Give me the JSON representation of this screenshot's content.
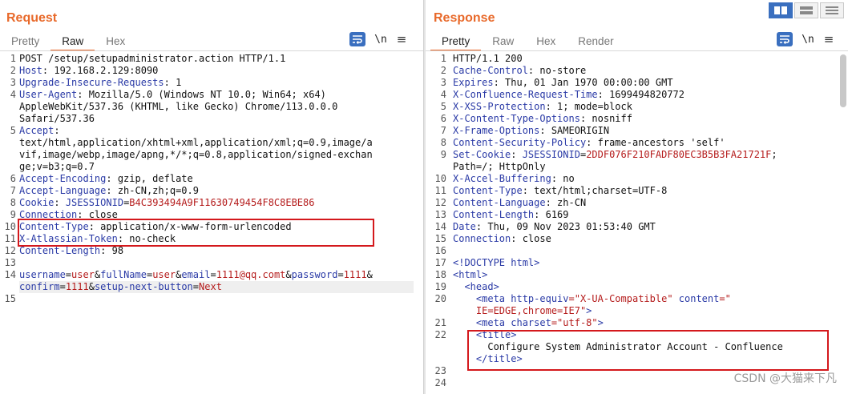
{
  "request": {
    "title": "Request",
    "tabs": [
      {
        "label": "Pretty",
        "active": false
      },
      {
        "label": "Raw",
        "active": true
      },
      {
        "label": "Hex",
        "active": false
      }
    ],
    "newline_label": "\\n",
    "menu_label": "≡",
    "lines": [
      {
        "n": "1",
        "parts": [
          {
            "t": "POST /setup/setupadministrator.action HTTP/1.1",
            "c": "hv"
          }
        ]
      },
      {
        "n": "2",
        "parts": [
          {
            "t": "Host",
            "c": "hk"
          },
          {
            "t": ": 192.168.2.129:8090",
            "c": "hv"
          }
        ]
      },
      {
        "n": "3",
        "parts": [
          {
            "t": "Upgrade-Insecure-Requests",
            "c": "hk"
          },
          {
            "t": ": 1",
            "c": "hv"
          }
        ]
      },
      {
        "n": "4",
        "parts": [
          {
            "t": "User-Agent",
            "c": "hk"
          },
          {
            "t": ": Mozilla/5.0 (Windows NT 10.0; Win64; x64)",
            "c": "hv"
          }
        ]
      },
      {
        "n": "",
        "parts": [
          {
            "t": "AppleWebKit/537.36 (KHTML, like Gecko) Chrome/113.0.0.0",
            "c": "hv"
          }
        ]
      },
      {
        "n": "",
        "parts": [
          {
            "t": "Safari/537.36",
            "c": "hv"
          }
        ]
      },
      {
        "n": "5",
        "parts": [
          {
            "t": "Accept",
            "c": "hk"
          },
          {
            "t": ":",
            "c": "hv"
          }
        ]
      },
      {
        "n": "",
        "parts": [
          {
            "t": "text/html,application/xhtml+xml,application/xml;q=0.9,image/a",
            "c": "hv"
          }
        ]
      },
      {
        "n": "",
        "parts": [
          {
            "t": "vif,image/webp,image/apng,*/*;q=0.8,application/signed-exchan",
            "c": "hv"
          }
        ]
      },
      {
        "n": "",
        "parts": [
          {
            "t": "ge;v=b3;q=0.7",
            "c": "hv"
          }
        ]
      },
      {
        "n": "6",
        "parts": [
          {
            "t": "Accept-Encoding",
            "c": "hk"
          },
          {
            "t": ": gzip, deflate",
            "c": "hv"
          }
        ]
      },
      {
        "n": "7",
        "parts": [
          {
            "t": "Accept-Language",
            "c": "hk"
          },
          {
            "t": ": zh-CN,zh;q=0.9",
            "c": "hv"
          }
        ]
      },
      {
        "n": "8",
        "parts": [
          {
            "t": "Cookie",
            "c": "hk"
          },
          {
            "t": ": ",
            "c": "hv"
          },
          {
            "t": "JSESSIONID",
            "c": "ck"
          },
          {
            "t": "=",
            "c": "hv"
          },
          {
            "t": "B4C393494A9F11630749454F8C8EBE86",
            "c": "cv"
          }
        ]
      },
      {
        "n": "9",
        "parts": [
          {
            "t": "Connection",
            "c": "hk"
          },
          {
            "t": ": close",
            "c": "hv"
          }
        ]
      },
      {
        "n": "10",
        "parts": [
          {
            "t": "Content-Type",
            "c": "hk"
          },
          {
            "t": ": application/x-www-form-urlencoded",
            "c": "hv"
          }
        ]
      },
      {
        "n": "11",
        "parts": [
          {
            "t": "X-Atlassian-Token",
            "c": "hk"
          },
          {
            "t": ": no-check",
            "c": "hv"
          }
        ]
      },
      {
        "n": "12",
        "parts": [
          {
            "t": "Content-Length",
            "c": "hk"
          },
          {
            "t": ": 98",
            "c": "hv"
          }
        ]
      },
      {
        "n": "13",
        "parts": []
      },
      {
        "n": "14",
        "parts": [
          {
            "t": "username",
            "c": "pk"
          },
          {
            "t": "=",
            "c": "amp"
          },
          {
            "t": "user",
            "c": "pv"
          },
          {
            "t": "&",
            "c": "amp"
          },
          {
            "t": "fullName",
            "c": "pk"
          },
          {
            "t": "=",
            "c": "amp"
          },
          {
            "t": "user",
            "c": "pv"
          },
          {
            "t": "&",
            "c": "amp"
          },
          {
            "t": "email",
            "c": "pk"
          },
          {
            "t": "=",
            "c": "amp"
          },
          {
            "t": "1111@qq.comt",
            "c": "pv"
          },
          {
            "t": "&",
            "c": "amp"
          },
          {
            "t": "password",
            "c": "pk"
          },
          {
            "t": "=",
            "c": "amp"
          },
          {
            "t": "1111",
            "c": "pv"
          },
          {
            "t": "&",
            "c": "amp"
          }
        ]
      },
      {
        "n": "",
        "parts": [
          {
            "t": "confirm",
            "c": "pk"
          },
          {
            "t": "=",
            "c": "amp"
          },
          {
            "t": "1111",
            "c": "pv"
          },
          {
            "t": "&",
            "c": "amp"
          },
          {
            "t": "setup-next-button",
            "c": "pk"
          },
          {
            "t": "=",
            "c": "amp"
          },
          {
            "t": "Next",
            "c": "pv"
          }
        ]
      },
      {
        "n": "15",
        "parts": []
      }
    ]
  },
  "response": {
    "title": "Response",
    "tabs": [
      {
        "label": "Pretty",
        "active": true
      },
      {
        "label": "Raw",
        "active": false
      },
      {
        "label": "Hex",
        "active": false
      },
      {
        "label": "Render",
        "active": false
      }
    ],
    "newline_label": "\\n",
    "menu_label": "≡",
    "lines": [
      {
        "n": "1",
        "parts": [
          {
            "t": "HTTP/1.1 200",
            "c": "hv"
          }
        ]
      },
      {
        "n": "2",
        "parts": [
          {
            "t": "Cache-Control",
            "c": "hk"
          },
          {
            "t": ": no-store",
            "c": "hv"
          }
        ]
      },
      {
        "n": "3",
        "parts": [
          {
            "t": "Expires",
            "c": "hk"
          },
          {
            "t": ": Thu, 01 Jan 1970 00:00:00 GMT",
            "c": "hv"
          }
        ]
      },
      {
        "n": "4",
        "parts": [
          {
            "t": "X-Confluence-Request-Time",
            "c": "hk"
          },
          {
            "t": ": 1699494820772",
            "c": "hv"
          }
        ]
      },
      {
        "n": "5",
        "parts": [
          {
            "t": "X-XSS-Protection",
            "c": "hk"
          },
          {
            "t": ": 1; mode=block",
            "c": "hv"
          }
        ]
      },
      {
        "n": "6",
        "parts": [
          {
            "t": "X-Content-Type-Options",
            "c": "hk"
          },
          {
            "t": ": nosniff",
            "c": "hv"
          }
        ]
      },
      {
        "n": "7",
        "parts": [
          {
            "t": "X-Frame-Options",
            "c": "hk"
          },
          {
            "t": ": SAMEORIGIN",
            "c": "hv"
          }
        ]
      },
      {
        "n": "8",
        "parts": [
          {
            "t": "Content-Security-Policy",
            "c": "hk"
          },
          {
            "t": ": frame-ancestors 'self'",
            "c": "hv"
          }
        ]
      },
      {
        "n": "9",
        "parts": [
          {
            "t": "Set-Cookie",
            "c": "hk"
          },
          {
            "t": ": ",
            "c": "hv"
          },
          {
            "t": "JSESSIONID",
            "c": "ck"
          },
          {
            "t": "=",
            "c": "hv"
          },
          {
            "t": "2DDF076F210FADF80EC3B5B3FA21721F",
            "c": "cv"
          },
          {
            "t": ";",
            "c": "hv"
          }
        ]
      },
      {
        "n": "",
        "parts": [
          {
            "t": "Path=/; HttpOnly",
            "c": "hv"
          }
        ]
      },
      {
        "n": "10",
        "parts": [
          {
            "t": "X-Accel-Buffering",
            "c": "hk"
          },
          {
            "t": ": no",
            "c": "hv"
          }
        ]
      },
      {
        "n": "11",
        "parts": [
          {
            "t": "Content-Type",
            "c": "hk"
          },
          {
            "t": ": text/html;charset=UTF-8",
            "c": "hv"
          }
        ]
      },
      {
        "n": "12",
        "parts": [
          {
            "t": "Content-Language",
            "c": "hk"
          },
          {
            "t": ": zh-CN",
            "c": "hv"
          }
        ]
      },
      {
        "n": "13",
        "parts": [
          {
            "t": "Content-Length",
            "c": "hk"
          },
          {
            "t": ": 6169",
            "c": "hv"
          }
        ]
      },
      {
        "n": "14",
        "parts": [
          {
            "t": "Date",
            "c": "hk"
          },
          {
            "t": ": Thu, 09 Nov 2023 01:53:40 GMT",
            "c": "hv"
          }
        ]
      },
      {
        "n": "15",
        "parts": [
          {
            "t": "Connection",
            "c": "hk"
          },
          {
            "t": ": close",
            "c": "hv"
          }
        ]
      },
      {
        "n": "16",
        "parts": []
      },
      {
        "n": "17",
        "parts": [
          {
            "t": "<!DOCTYPE html>",
            "c": "tag"
          }
        ]
      },
      {
        "n": "18",
        "parts": [
          {
            "t": "<html>",
            "c": "tag"
          }
        ]
      },
      {
        "n": "19",
        "parts": [
          {
            "t": "  <head>",
            "c": "tag"
          }
        ]
      },
      {
        "n": "20",
        "parts": [
          {
            "t": "    <meta ",
            "c": "tag"
          },
          {
            "t": "http-equiv",
            "c": "attr"
          },
          {
            "t": "=\"X-UA-Compatible\" ",
            "c": "aval"
          },
          {
            "t": "content",
            "c": "attr"
          },
          {
            "t": "=\"",
            "c": "aval"
          }
        ]
      },
      {
        "n": "",
        "parts": [
          {
            "t": "    IE=EDGE,chrome=IE7\"",
            "c": "aval"
          },
          {
            "t": ">",
            "c": "tag"
          }
        ]
      },
      {
        "n": "21",
        "parts": [
          {
            "t": "    <meta ",
            "c": "tag"
          },
          {
            "t": "charset",
            "c": "attr"
          },
          {
            "t": "=\"utf-8\"",
            "c": "aval"
          },
          {
            "t": ">",
            "c": "tag"
          }
        ]
      },
      {
        "n": "22",
        "parts": [
          {
            "t": "    <title>",
            "c": "tag"
          }
        ]
      },
      {
        "n": "",
        "parts": [
          {
            "t": "      Configure System Administrator Account - Confluence",
            "c": "hv"
          }
        ]
      },
      {
        "n": "",
        "parts": [
          {
            "t": "    </title>",
            "c": "tag"
          }
        ]
      },
      {
        "n": "23",
        "parts": []
      },
      {
        "n": "24",
        "parts": []
      }
    ]
  },
  "watermark": "CSDN @大猫来下凡"
}
